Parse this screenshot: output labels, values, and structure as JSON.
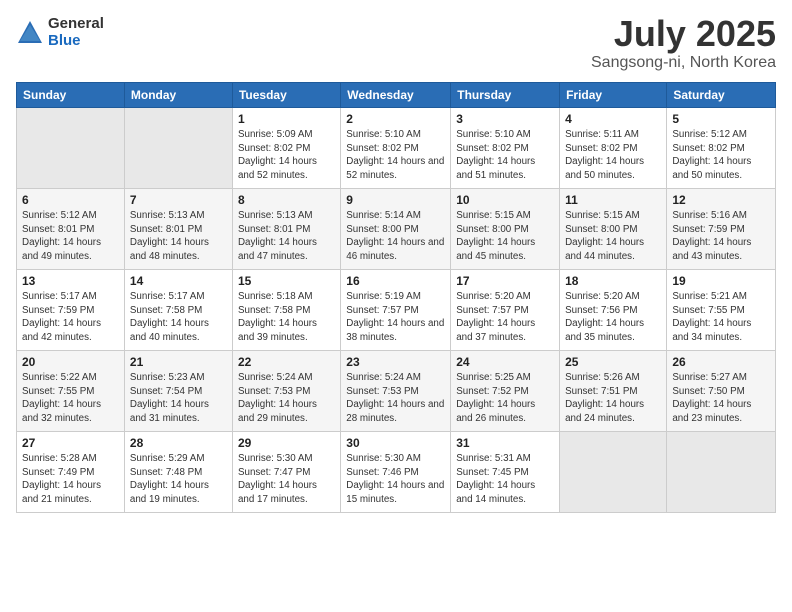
{
  "logo": {
    "general": "General",
    "blue": "Blue"
  },
  "title": "July 2025",
  "location": "Sangsong-ni, North Korea",
  "days_header": [
    "Sunday",
    "Monday",
    "Tuesday",
    "Wednesday",
    "Thursday",
    "Friday",
    "Saturday"
  ],
  "weeks": [
    [
      {
        "day": "",
        "empty": true
      },
      {
        "day": "",
        "empty": true
      },
      {
        "day": "1",
        "sunrise": "Sunrise: 5:09 AM",
        "sunset": "Sunset: 8:02 PM",
        "daylight": "Daylight: 14 hours and 52 minutes."
      },
      {
        "day": "2",
        "sunrise": "Sunrise: 5:10 AM",
        "sunset": "Sunset: 8:02 PM",
        "daylight": "Daylight: 14 hours and 52 minutes."
      },
      {
        "day": "3",
        "sunrise": "Sunrise: 5:10 AM",
        "sunset": "Sunset: 8:02 PM",
        "daylight": "Daylight: 14 hours and 51 minutes."
      },
      {
        "day": "4",
        "sunrise": "Sunrise: 5:11 AM",
        "sunset": "Sunset: 8:02 PM",
        "daylight": "Daylight: 14 hours and 50 minutes."
      },
      {
        "day": "5",
        "sunrise": "Sunrise: 5:12 AM",
        "sunset": "Sunset: 8:02 PM",
        "daylight": "Daylight: 14 hours and 50 minutes."
      }
    ],
    [
      {
        "day": "6",
        "sunrise": "Sunrise: 5:12 AM",
        "sunset": "Sunset: 8:01 PM",
        "daylight": "Daylight: 14 hours and 49 minutes."
      },
      {
        "day": "7",
        "sunrise": "Sunrise: 5:13 AM",
        "sunset": "Sunset: 8:01 PM",
        "daylight": "Daylight: 14 hours and 48 minutes."
      },
      {
        "day": "8",
        "sunrise": "Sunrise: 5:13 AM",
        "sunset": "Sunset: 8:01 PM",
        "daylight": "Daylight: 14 hours and 47 minutes."
      },
      {
        "day": "9",
        "sunrise": "Sunrise: 5:14 AM",
        "sunset": "Sunset: 8:00 PM",
        "daylight": "Daylight: 14 hours and 46 minutes."
      },
      {
        "day": "10",
        "sunrise": "Sunrise: 5:15 AM",
        "sunset": "Sunset: 8:00 PM",
        "daylight": "Daylight: 14 hours and 45 minutes."
      },
      {
        "day": "11",
        "sunrise": "Sunrise: 5:15 AM",
        "sunset": "Sunset: 8:00 PM",
        "daylight": "Daylight: 14 hours and 44 minutes."
      },
      {
        "day": "12",
        "sunrise": "Sunrise: 5:16 AM",
        "sunset": "Sunset: 7:59 PM",
        "daylight": "Daylight: 14 hours and 43 minutes."
      }
    ],
    [
      {
        "day": "13",
        "sunrise": "Sunrise: 5:17 AM",
        "sunset": "Sunset: 7:59 PM",
        "daylight": "Daylight: 14 hours and 42 minutes."
      },
      {
        "day": "14",
        "sunrise": "Sunrise: 5:17 AM",
        "sunset": "Sunset: 7:58 PM",
        "daylight": "Daylight: 14 hours and 40 minutes."
      },
      {
        "day": "15",
        "sunrise": "Sunrise: 5:18 AM",
        "sunset": "Sunset: 7:58 PM",
        "daylight": "Daylight: 14 hours and 39 minutes."
      },
      {
        "day": "16",
        "sunrise": "Sunrise: 5:19 AM",
        "sunset": "Sunset: 7:57 PM",
        "daylight": "Daylight: 14 hours and 38 minutes."
      },
      {
        "day": "17",
        "sunrise": "Sunrise: 5:20 AM",
        "sunset": "Sunset: 7:57 PM",
        "daylight": "Daylight: 14 hours and 37 minutes."
      },
      {
        "day": "18",
        "sunrise": "Sunrise: 5:20 AM",
        "sunset": "Sunset: 7:56 PM",
        "daylight": "Daylight: 14 hours and 35 minutes."
      },
      {
        "day": "19",
        "sunrise": "Sunrise: 5:21 AM",
        "sunset": "Sunset: 7:55 PM",
        "daylight": "Daylight: 14 hours and 34 minutes."
      }
    ],
    [
      {
        "day": "20",
        "sunrise": "Sunrise: 5:22 AM",
        "sunset": "Sunset: 7:55 PM",
        "daylight": "Daylight: 14 hours and 32 minutes."
      },
      {
        "day": "21",
        "sunrise": "Sunrise: 5:23 AM",
        "sunset": "Sunset: 7:54 PM",
        "daylight": "Daylight: 14 hours and 31 minutes."
      },
      {
        "day": "22",
        "sunrise": "Sunrise: 5:24 AM",
        "sunset": "Sunset: 7:53 PM",
        "daylight": "Daylight: 14 hours and 29 minutes."
      },
      {
        "day": "23",
        "sunrise": "Sunrise: 5:24 AM",
        "sunset": "Sunset: 7:53 PM",
        "daylight": "Daylight: 14 hours and 28 minutes."
      },
      {
        "day": "24",
        "sunrise": "Sunrise: 5:25 AM",
        "sunset": "Sunset: 7:52 PM",
        "daylight": "Daylight: 14 hours and 26 minutes."
      },
      {
        "day": "25",
        "sunrise": "Sunrise: 5:26 AM",
        "sunset": "Sunset: 7:51 PM",
        "daylight": "Daylight: 14 hours and 24 minutes."
      },
      {
        "day": "26",
        "sunrise": "Sunrise: 5:27 AM",
        "sunset": "Sunset: 7:50 PM",
        "daylight": "Daylight: 14 hours and 23 minutes."
      }
    ],
    [
      {
        "day": "27",
        "sunrise": "Sunrise: 5:28 AM",
        "sunset": "Sunset: 7:49 PM",
        "daylight": "Daylight: 14 hours and 21 minutes."
      },
      {
        "day": "28",
        "sunrise": "Sunrise: 5:29 AM",
        "sunset": "Sunset: 7:48 PM",
        "daylight": "Daylight: 14 hours and 19 minutes."
      },
      {
        "day": "29",
        "sunrise": "Sunrise: 5:30 AM",
        "sunset": "Sunset: 7:47 PM",
        "daylight": "Daylight: 14 hours and 17 minutes."
      },
      {
        "day": "30",
        "sunrise": "Sunrise: 5:30 AM",
        "sunset": "Sunset: 7:46 PM",
        "daylight": "Daylight: 14 hours and 15 minutes."
      },
      {
        "day": "31",
        "sunrise": "Sunrise: 5:31 AM",
        "sunset": "Sunset: 7:45 PM",
        "daylight": "Daylight: 14 hours and 14 minutes."
      },
      {
        "day": "",
        "empty": true
      },
      {
        "day": "",
        "empty": true
      }
    ]
  ]
}
